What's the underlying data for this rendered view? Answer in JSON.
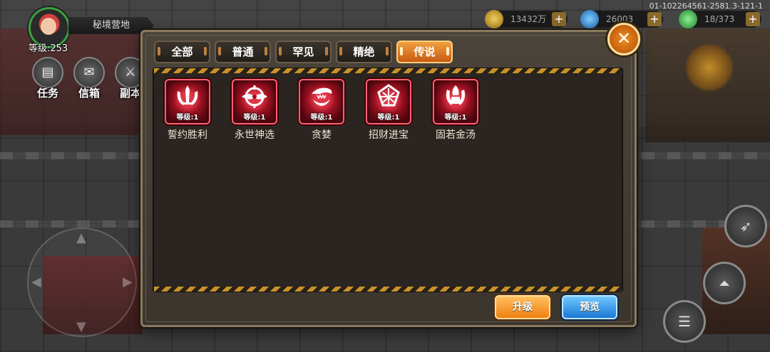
{
  "hud": {
    "player_level": "等级:253",
    "zone_name": "秘境营地",
    "build_id": "01-102264561-2581.3-121-1",
    "left_icons": [
      {
        "label": "任务",
        "icon": "quest-icon"
      },
      {
        "label": "信箱",
        "icon": "mail-icon"
      },
      {
        "label": "副本",
        "icon": "dungeon-icon"
      }
    ],
    "currencies": [
      {
        "value": "13432万",
        "icon": "gold-coin-icon",
        "color": "#d4a020"
      },
      {
        "value": "26003",
        "icon": "blue-gem-icon",
        "color": "#2a8ae0"
      },
      {
        "value": "18/373",
        "icon": "green-crystal-icon",
        "color": "#30b040"
      }
    ]
  },
  "dialog": {
    "close_symbol": "✕",
    "tabs": [
      {
        "label": "全部",
        "active": false
      },
      {
        "label": "普通",
        "active": false
      },
      {
        "label": "罕见",
        "active": false
      },
      {
        "label": "精绝",
        "active": false
      },
      {
        "label": "传说",
        "active": true
      }
    ],
    "items": [
      {
        "name": "誓约胜利",
        "level": "等级:1",
        "icon": "sword-emblem-icon"
      },
      {
        "name": "永世神选",
        "level": "等级:1",
        "icon": "winged-eye-icon"
      },
      {
        "name": "贪婪",
        "level": "等级:1",
        "icon": "jaw-icon"
      },
      {
        "name": "招财进宝",
        "level": "等级:1",
        "icon": "lattice-shield-icon"
      },
      {
        "name": "固若金汤",
        "level": "等级:1",
        "icon": "helmet-crest-icon"
      }
    ],
    "buttons": {
      "upgrade": "升级",
      "preview": "预览"
    }
  },
  "colors": {
    "active_tab": "#e87a20",
    "upgrade_button": "#f09020",
    "preview_button": "#2a8ae0",
    "item_frame": "#c01428"
  }
}
